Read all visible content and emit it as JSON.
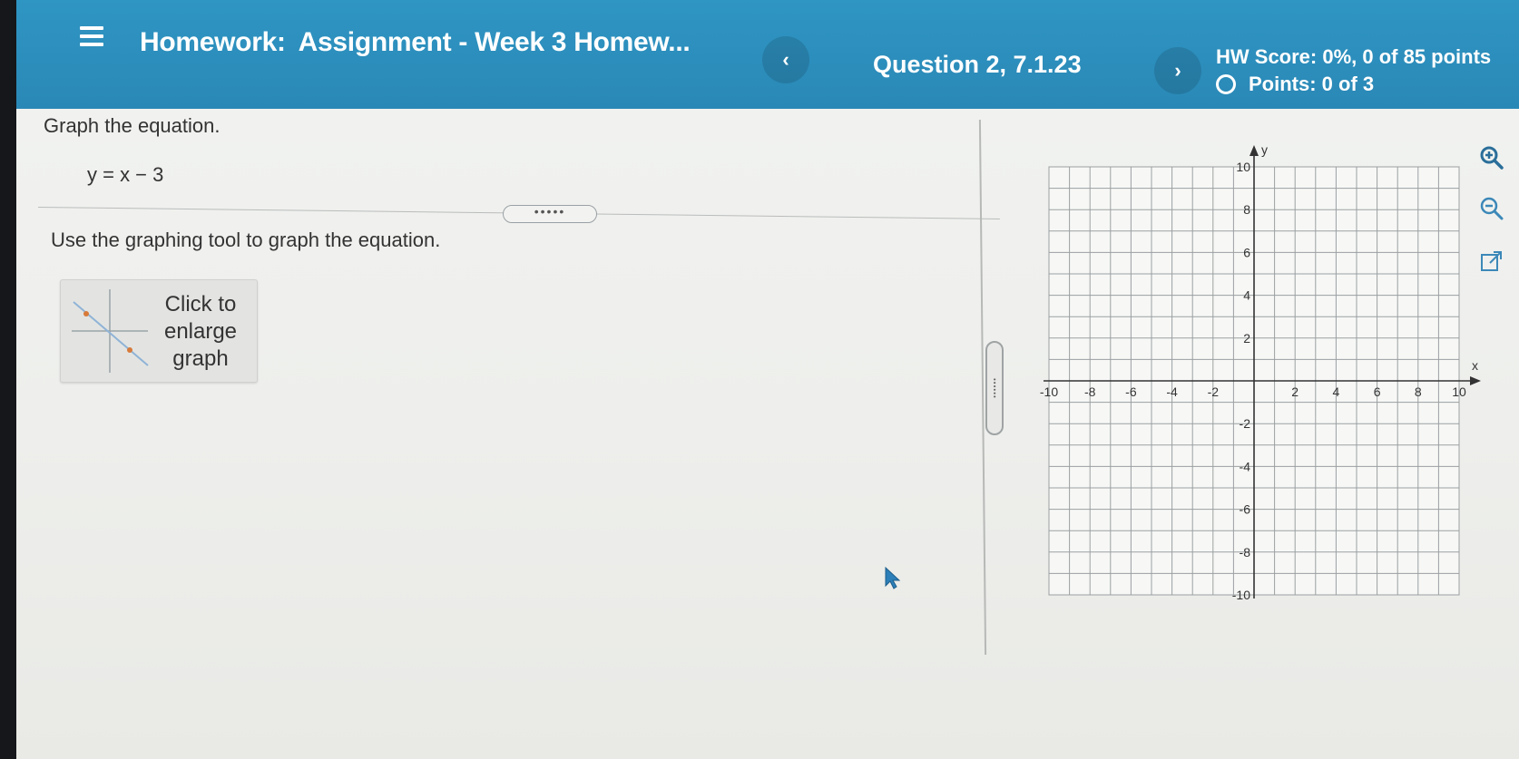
{
  "header": {
    "title_prefix": "Homework:",
    "title": "Assignment - Week 3 Homew...",
    "question": "Question 2, 7.1.23",
    "prev_glyph": "‹",
    "next_glyph": "›",
    "hw_score": "HW Score: 0%, 0 of 85 points",
    "points": "Points: 0 of 3",
    "bg_color": "#2f95c3"
  },
  "problem": {
    "instruction": "Graph the equation.",
    "equation": "y = x − 3",
    "more_dots": "•••••",
    "tool_instruction": "Use the graphing tool to graph the equation.",
    "enlarge_label": "Click to enlarge graph"
  },
  "graph": {
    "x_label": "x",
    "y_label": "y",
    "x_min": -10,
    "x_max": 10,
    "y_min": -10,
    "y_max": 10,
    "grid_step": 1,
    "tick_labels_x": [
      "-10",
      "-8",
      "-6",
      "-4",
      "-2",
      "2",
      "4",
      "6",
      "8",
      "10"
    ],
    "tick_labels_y": [
      "10",
      "8",
      "6",
      "4",
      "2",
      "-2",
      "-4",
      "-6",
      "-8",
      "-10"
    ],
    "tools": [
      "zoom-in-icon",
      "zoom-out-icon",
      "popout-icon"
    ]
  }
}
